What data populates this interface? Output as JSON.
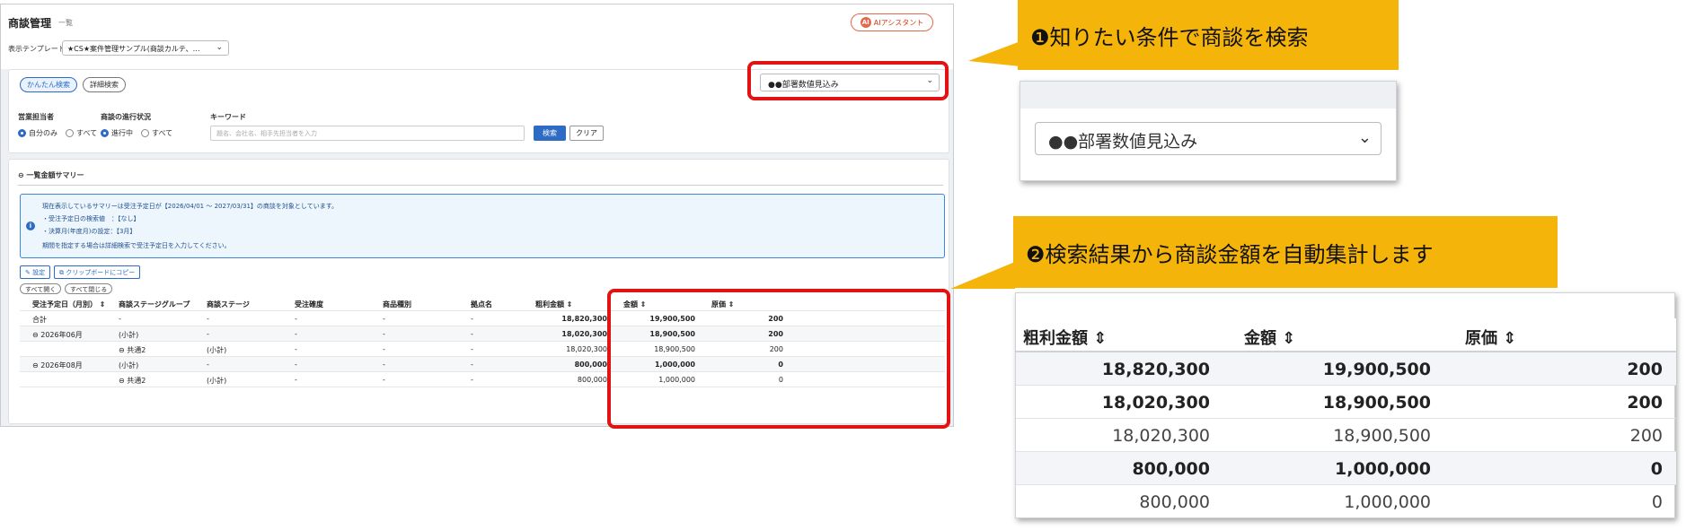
{
  "app": {
    "title": "商談管理",
    "subtitle": "一覧",
    "ai_button": "AIアシスタント",
    "ai_icon": "AI",
    "template_label": "表示テンプレート",
    "template_value": "★CS★案件管理サンプル(商談カルテ、…",
    "tabs": {
      "simple": "かんたん検索",
      "detail": "詳細検索"
    },
    "condition_select": "●●部署数値見込み",
    "filters": {
      "sales_rep": {
        "label": "営業担当者",
        "opt1": "自分のみ",
        "opt2": "すべて"
      },
      "progress": {
        "label": "商談の進行状況",
        "opt1": "進行中",
        "opt2": "すべて"
      },
      "keyword": {
        "label": "キーワード",
        "placeholder": "題名、会社名、相手先担当者を入力"
      }
    },
    "search_button": "検索",
    "clear_button": "クリア",
    "summary_title": "一覧金額サマリー",
    "info": {
      "line1": "現在表示しているサマリーは受注予定日が【2026/04/01 ～ 2027/03/31】の商談を対象としています。",
      "line2": "・受注予定日の検索値　：【なし】",
      "line3": "・決算月(年度月)の設定：【3月】",
      "line4": "期間を指定する場合は詳細検索で受注予定日を入力してください。"
    },
    "settings_button": "設定",
    "copy_button": "クリップボードにコピー",
    "expand_all": "すべて開く",
    "collapse_all": "すべて閉じる",
    "table": {
      "headers": [
        "受注予定日（月別）",
        "商談ステージグループ",
        "商談ステージ",
        "受注確度",
        "商品種別",
        "拠点名",
        "粗利金額",
        "金額",
        "原価"
      ],
      "rows": [
        {
          "c1": "合計",
          "c2": "-",
          "c3": "-",
          "c4": "-",
          "c5": "-",
          "c6": "-",
          "c7": "18,820,300",
          "c8": "19,900,500",
          "c9": "200"
        },
        {
          "c1": "2026年06月",
          "c2": "(小計)",
          "c3": "-",
          "c4": "-",
          "c5": "-",
          "c6": "-",
          "c7": "18,020,300",
          "c8": "18,900,500",
          "c9": "200"
        },
        {
          "c1": "",
          "c2": "共通2",
          "c3": "(小計)",
          "c4": "-",
          "c5": "-",
          "c6": "-",
          "c7": "18,020,300",
          "c8": "18,900,500",
          "c9": "200"
        },
        {
          "c1": "2026年08月",
          "c2": "(小計)",
          "c3": "-",
          "c4": "-",
          "c5": "-",
          "c6": "-",
          "c7": "800,000",
          "c8": "1,000,000",
          "c9": "0"
        },
        {
          "c1": "",
          "c2": "共通2",
          "c3": "(小計)",
          "c4": "-",
          "c5": "-",
          "c6": "-",
          "c7": "800,000",
          "c8": "1,000,000",
          "c9": "0"
        }
      ]
    }
  },
  "callouts": {
    "step1": "❶知りたい条件で商談を検索",
    "step2": "❷検索結果から商談金額を自動集計します"
  },
  "zoom": {
    "select_value": "●●部署数値見込み",
    "headers": [
      "粗利金額 ⇕",
      "金額 ⇕",
      "原価 ⇕"
    ],
    "rows": [
      [
        "18,820,300",
        "19,900,500",
        "200"
      ],
      [
        "18,020,300",
        "18,900,500",
        "200"
      ],
      [
        "18,020,300",
        "18,900,500",
        "200"
      ],
      [
        "800,000",
        "1,000,000",
        "0"
      ],
      [
        "800,000",
        "1,000,000",
        "0"
      ]
    ]
  },
  "colors": {
    "accent": "#2d6bc4",
    "highlight": "#e21313",
    "callout": "#f5b40a"
  }
}
